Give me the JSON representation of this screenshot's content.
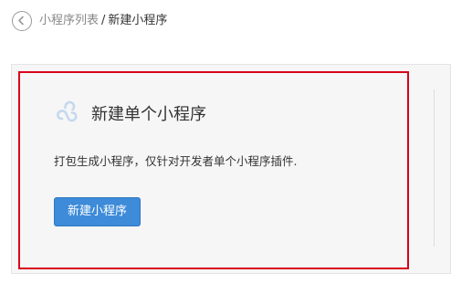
{
  "header": {
    "back_icon": "chevron-left-circle-icon",
    "breadcrumb_parent": "小程序列表",
    "breadcrumb_separator": "/",
    "breadcrumb_current": "新建小程序"
  },
  "card": {
    "icon": "mini-program-logo-icon",
    "title": "新建单个小程序",
    "description": "打包生成小程序，仅针对开发者单个小程序插件.",
    "button_label": "新建小程序"
  },
  "colors": {
    "primary_button": "#3d8bd9",
    "highlight_border": "#d9001b",
    "panel_background": "#f6f6f7",
    "icon_color": "#c5d8ee"
  }
}
